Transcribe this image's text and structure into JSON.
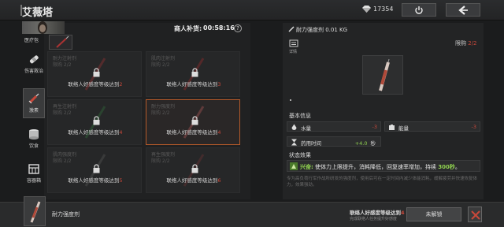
{
  "header": {
    "title": "艾薇塔",
    "currency_value": "17354"
  },
  "merchant": {
    "label": "商人补货:",
    "time": "00:58:16",
    "help": "?"
  },
  "sidebar": {
    "items": [
      {
        "label": "医疗包",
        "icon": "medkit-icon"
      },
      {
        "label": "伤害救治",
        "icon": "bandage-icon"
      },
      {
        "label": "激素",
        "icon": "syringe-icon"
      },
      {
        "label": "饮食",
        "icon": "food-can-icon"
      },
      {
        "label": "容器箱",
        "icon": "container-box-icon"
      }
    ]
  },
  "grid": {
    "items": [
      {
        "name": "耐力注射剂",
        "limit": "限购 2/2",
        "req_text": "联络人好感度等级达到",
        "req_level": "2"
      },
      {
        "name": "肌肉注射剂",
        "limit": "限购 2/2",
        "req_text": "联络人好感度等级达到",
        "req_level": "3"
      },
      {
        "name": "再生注射剂",
        "limit": "限购 2/2",
        "req_text": "联络人好感度等级达到",
        "req_level": "4"
      },
      {
        "name": "耐力强度剂",
        "limit": "限购 2/2",
        "req_text": "联络人好感度等级达到",
        "req_level": "4"
      },
      {
        "name": "肌肉强度剂",
        "limit": "限购 2/2",
        "req_text": "联络人好感度等级达到",
        "req_level": "5"
      },
      {
        "name": "再生强度剂",
        "limit": "限购 2/2",
        "req_text": "联络人好感度等级达到",
        "req_level": "6"
      }
    ]
  },
  "detail": {
    "name": "耐力强度剂 0.01 KG",
    "detail_label": "详情",
    "limit_label": "限购",
    "limit_value": "2/2",
    "basic_info_title": "基本信息",
    "stats": [
      {
        "label": "水量",
        "value": "-3",
        "icon": "water-drop-icon"
      },
      {
        "label": "能量",
        "value": "-3",
        "icon": "energy-icon"
      }
    ],
    "duration_label": "药用时间",
    "duration_value": "+4.0",
    "duration_unit": "秒",
    "status_title": "状态效果",
    "effect_tag": "兴奋:",
    "effect_text": " 使体力上限提升，消耗降低，回复速率增加，持续 ",
    "effect_duration": "300秒",
    "effect_end": "。",
    "description": "专为高负荷行军作战所研发的强度剂，使用后可在一定时间内减少体能消耗，缓解疲劳并快速恢复体力，效果强劲。"
  },
  "bottom": {
    "item_name": "耐力强度剂",
    "req_text": "联络人好感度等级达到",
    "req_level": "4",
    "req_sub": "完成联络人任务提升好感度",
    "unlock_label": "未解锁"
  },
  "colors": {
    "accent_red": "#c8483a",
    "accent_green": "#8fd14f",
    "selected_border": "#b55a2a"
  }
}
